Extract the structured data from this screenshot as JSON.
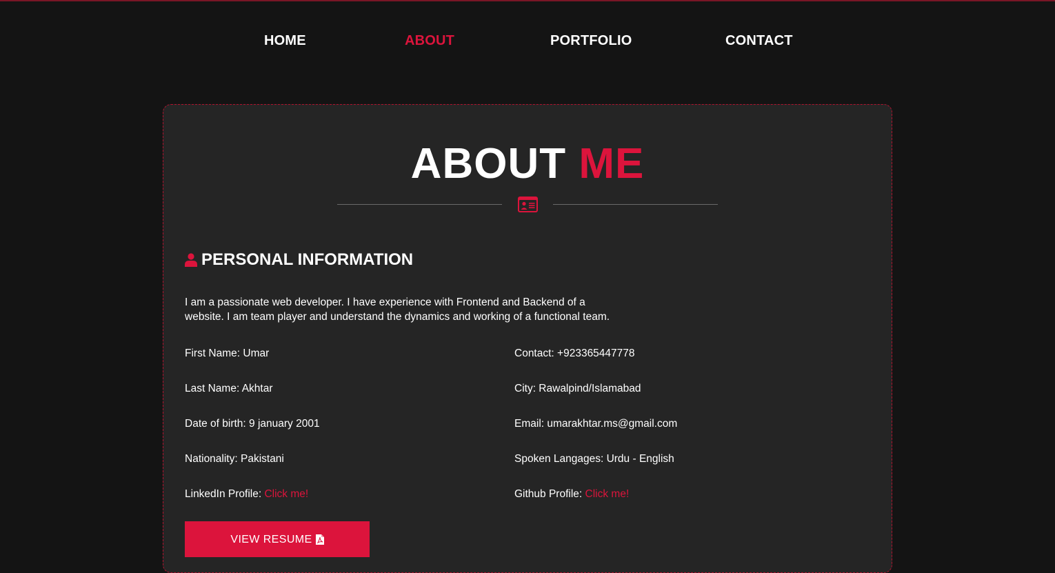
{
  "nav": {
    "items": [
      {
        "label": "HOME",
        "active": false
      },
      {
        "label": "ABOUT",
        "active": true
      },
      {
        "label": "PORTFOLIO",
        "active": false
      },
      {
        "label": "CONTACT",
        "active": false
      }
    ]
  },
  "about": {
    "title_main": "ABOUT",
    "title_accent": "ME",
    "divider_icon": "id-card-icon"
  },
  "personal": {
    "heading": "PERSONAL INFORMATION",
    "heading_icon": "user-icon",
    "bio": "I am a passionate web developer. I have experience with Frontend and Backend of a website. I am team player and understand the dynamics and working of a functional team.",
    "left": [
      {
        "text": "First Name: Umar"
      },
      {
        "text": "Last Name: Akhtar"
      },
      {
        "text": "Date of birth: 9 january 2001"
      },
      {
        "text": "Nationality: Pakistani"
      },
      {
        "text": "LinkedIn Profile: ",
        "link": "Click me!"
      }
    ],
    "right": [
      {
        "text": "Contact: +923365447778"
      },
      {
        "text": "City: Rawalpind/Islamabad"
      },
      {
        "text": "Email: umarakhtar.ms@gmail.com"
      },
      {
        "text": "Spoken Langages: Urdu - English"
      },
      {
        "text": "Github Profile: ",
        "link": "Click me!"
      }
    ]
  },
  "resume": {
    "label": "VIEW RESUME",
    "icon": "pdf-file-icon"
  },
  "colors": {
    "accent": "#dc143c",
    "background": "#141414",
    "card": "#252525"
  }
}
